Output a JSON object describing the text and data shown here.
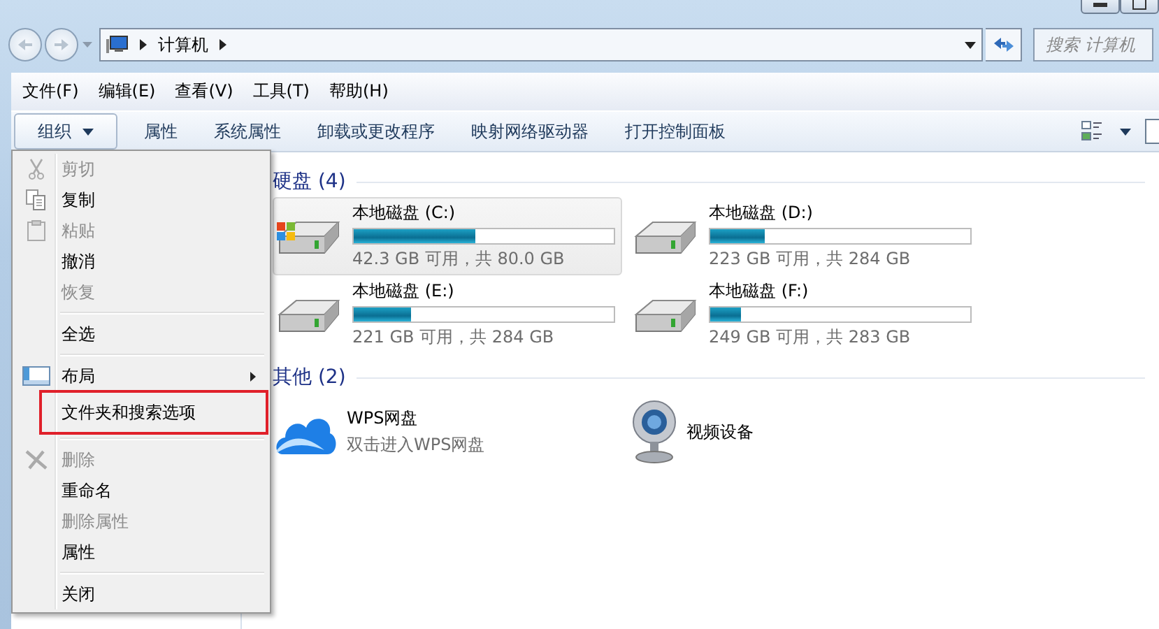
{
  "address_bar": {
    "path": [
      "计算机"
    ]
  },
  "search": {
    "placeholder": "搜索 计算机"
  },
  "menu_bar": [
    "文件(F)",
    "编辑(E)",
    "查看(V)",
    "工具(T)",
    "帮助(H)"
  ],
  "toolbar": {
    "organize": {
      "label": "组织",
      "expanded": true
    },
    "buttons": [
      "属性",
      "系统属性",
      "卸载或更改程序",
      "映射网络驱动器",
      "打开控制面板"
    ]
  },
  "organize_menu": [
    {
      "kind": "item",
      "label": "剪切",
      "disabled": true,
      "submenu": false,
      "highlighted": false
    },
    {
      "kind": "item",
      "label": "复制",
      "disabled": false,
      "submenu": false,
      "highlighted": false
    },
    {
      "kind": "item",
      "label": "粘贴",
      "disabled": true,
      "submenu": false,
      "highlighted": false
    },
    {
      "kind": "item",
      "label": "撤消",
      "disabled": false,
      "submenu": false,
      "highlighted": false
    },
    {
      "kind": "item",
      "label": "恢复",
      "disabled": true,
      "submenu": false,
      "highlighted": false
    },
    {
      "kind": "separator"
    },
    {
      "kind": "item",
      "label": "全选",
      "disabled": false,
      "submenu": false,
      "highlighted": false
    },
    {
      "kind": "separator"
    },
    {
      "kind": "item",
      "label": "布局",
      "disabled": false,
      "submenu": true,
      "highlighted": false
    },
    {
      "kind": "item",
      "label": "文件夹和搜索选项",
      "disabled": false,
      "submenu": false,
      "highlighted": true
    },
    {
      "kind": "separator"
    },
    {
      "kind": "item",
      "label": "删除",
      "disabled": true,
      "submenu": false,
      "highlighted": false
    },
    {
      "kind": "item",
      "label": "重命名",
      "disabled": false,
      "submenu": false,
      "highlighted": false
    },
    {
      "kind": "item",
      "label": "删除属性",
      "disabled": true,
      "submenu": false,
      "highlighted": false
    },
    {
      "kind": "item",
      "label": "属性",
      "disabled": false,
      "submenu": false,
      "highlighted": false
    },
    {
      "kind": "separator"
    },
    {
      "kind": "item",
      "label": "关闭",
      "disabled": false,
      "submenu": false,
      "highlighted": false
    }
  ],
  "sections": [
    {
      "title": "硬盘 (4)",
      "items": [
        {
          "kind": "drive",
          "name": "本地磁盘 (C:)",
          "detail": "42.3 GB 可用，共 80.0 GB",
          "level": 0.47,
          "selected": true
        },
        {
          "kind": "drive",
          "name": "本地磁盘 (D:)",
          "detail": "223 GB 可用，共 284 GB",
          "level": 0.21,
          "selected": false
        },
        {
          "kind": "drive",
          "name": "本地磁盘 (E:)",
          "detail": "221 GB 可用，共 284 GB",
          "level": 0.22,
          "selected": false
        },
        {
          "kind": "drive",
          "name": "本地磁盘 (F:)",
          "detail": "249 GB 可用，共 283 GB",
          "level": 0.12,
          "selected": false
        }
      ]
    },
    {
      "title": "其他 (2)",
      "items": [
        {
          "kind": "cloud",
          "name": "WPS网盘",
          "detail": "双击进入WPS网盘",
          "selected": false
        },
        {
          "kind": "device",
          "name": "视频设备",
          "selected": false
        }
      ]
    }
  ]
}
